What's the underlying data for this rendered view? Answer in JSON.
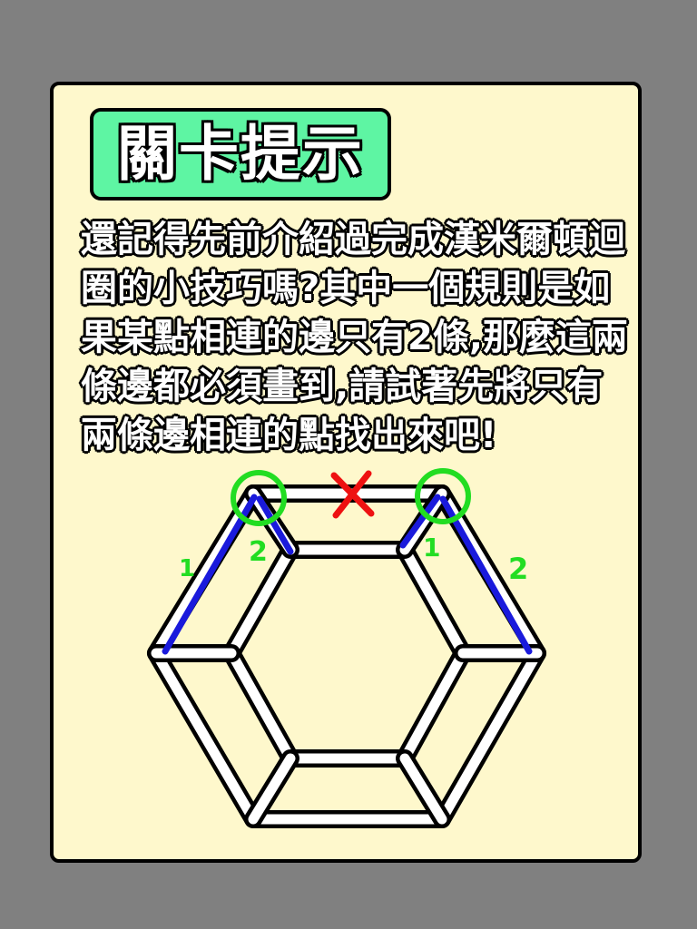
{
  "title": "關卡提示",
  "hint": "還記得先前介紹過完成漢米爾頓迴圈的小技巧嗎?其中一個規則是如果某點相連的邊只有2條,那麼這兩條邊都必須畫到,請試著先將只有兩條邊相連的點找出來吧!",
  "diagram": {
    "left_vertex_labels": [
      "1",
      "2"
    ],
    "right_vertex_labels": [
      "1",
      "2"
    ],
    "colors": {
      "background": "#808080",
      "card": "#fef8cc",
      "badge": "#5ef5a3",
      "highlight_edge": "#1a1adc",
      "circle": "#22dd22",
      "cross": "#ee1111"
    }
  }
}
